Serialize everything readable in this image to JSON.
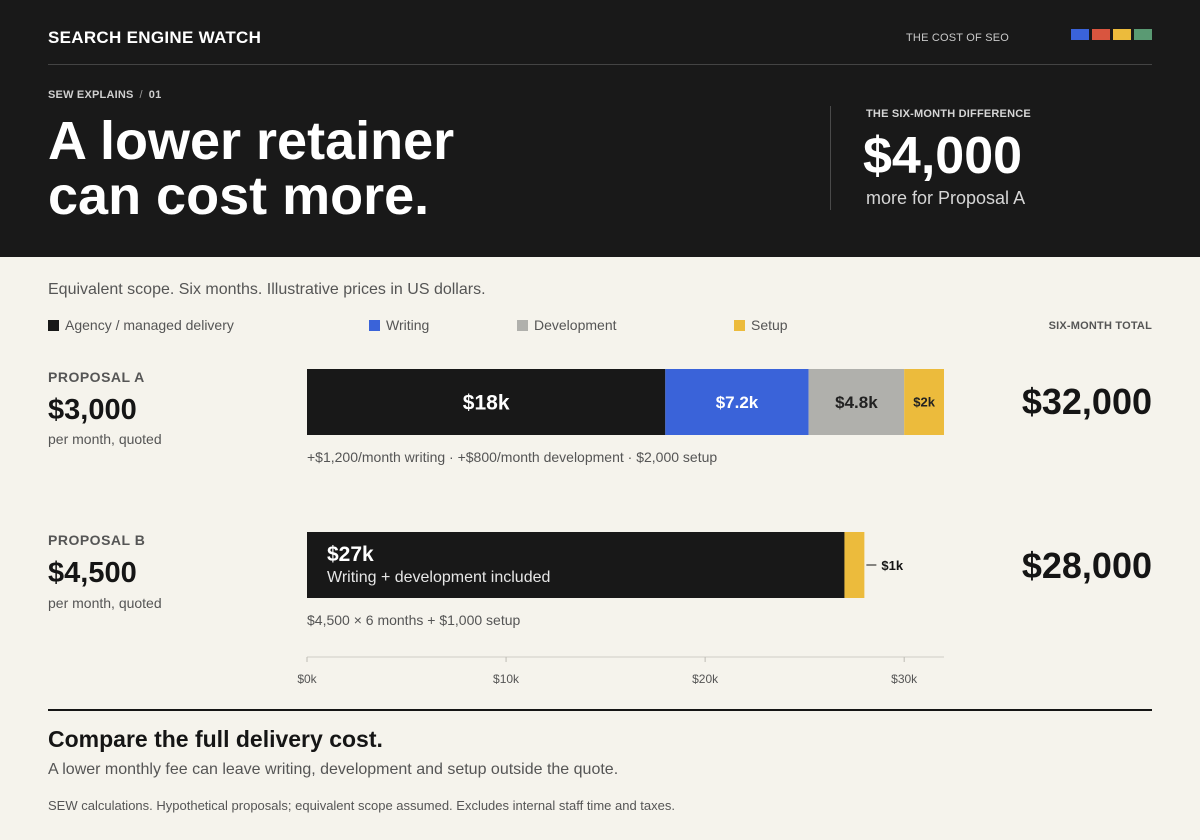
{
  "header": {
    "brand": "SEARCH ENGINE WATCH",
    "kicker": "THE COST OF SEO",
    "swatch_colors": [
      "#3a63d9",
      "#d9553f",
      "#ecbb3c",
      "#5a9a73"
    ],
    "breadcrumb_section": "SEW EXPLAINS",
    "breadcrumb_sep": "/",
    "breadcrumb_number": "01",
    "headline_line1": "A lower retainer",
    "headline_line2": "can cost more.",
    "difference_label": "THE SIX-MONTH DIFFERENCE",
    "difference_value": "$4,000",
    "difference_note": "more for Proposal A"
  },
  "subtitle": "Equivalent scope. Six months. Illustrative prices in US dollars.",
  "legend": [
    {
      "label": "Agency / managed delivery",
      "color": "#181818"
    },
    {
      "label": "Writing",
      "color": "#3a63d9"
    },
    {
      "label": "Development",
      "color": "#b0b0ac"
    },
    {
      "label": "Setup",
      "color": "#ecbb3c"
    }
  ],
  "total_header": "SIX-MONTH TOTAL",
  "proposals": [
    {
      "name": "PROPOSAL A",
      "monthly": "$3,000",
      "monthly_note": "per month, quoted",
      "total": "$32,000",
      "detail": "+$1,200/month writing  ·  +$800/month development  ·  $2,000 setup"
    },
    {
      "name": "PROPOSAL B",
      "monthly": "$4,500",
      "monthly_note": "per month, quoted",
      "total": "$28,000",
      "detail": "$4,500 × 6 months + $1,000 setup"
    }
  ],
  "chart_data": {
    "type": "bar",
    "orientation": "horizontal",
    "stacked": true,
    "categories": [
      "PROPOSAL A",
      "PROPOSAL B"
    ],
    "series": [
      {
        "name": "Agency / managed delivery",
        "color": "#181818",
        "values": [
          18000,
          27000
        ],
        "labels": [
          "$18k",
          "$27k"
        ]
      },
      {
        "name": "Writing",
        "color": "#3a63d9",
        "values": [
          7200,
          0
        ],
        "labels": [
          "$7.2k",
          ""
        ]
      },
      {
        "name": "Development",
        "color": "#b0b0ac",
        "values": [
          4800,
          0
        ],
        "labels": [
          "$4.8k",
          ""
        ]
      },
      {
        "name": "Setup",
        "color": "#ecbb3c",
        "values": [
          2000,
          1000
        ],
        "labels": [
          "$2k",
          "$1k"
        ]
      }
    ],
    "bar_b_note": "Writing + development included",
    "xlim": [
      0,
      32000
    ],
    "xticks": [
      0,
      10000,
      20000,
      30000
    ],
    "xtick_labels": [
      "$0k",
      "$10k",
      "$20k",
      "$30k"
    ],
    "grid": false
  },
  "footer": {
    "conclusion": "Compare the full delivery cost.",
    "conclusion_sub": "A lower monthly fee can leave writing, development and setup outside the quote.",
    "source": "SEW calculations. Hypothetical proposals; equivalent scope assumed. Excludes internal staff time and taxes."
  }
}
